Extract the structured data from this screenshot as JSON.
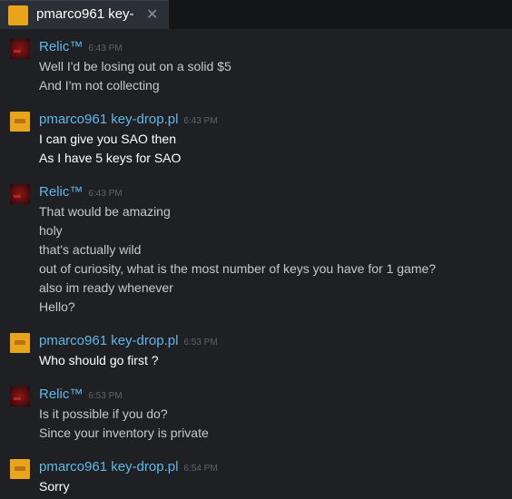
{
  "tab": {
    "title": "pmarco961 key-",
    "close_glyph": "✕"
  },
  "messages": [
    {
      "author": "Relic™",
      "time": "6:43 PM",
      "lines": [
        "Well I'd be losing out on a solid $5",
        "And I'm not collecting"
      ]
    },
    {
      "author": "pmarco961 key-drop.pl",
      "time": "6:43 PM",
      "lines": [
        "I can give you SAO then",
        "As I have 5 keys for SAO"
      ]
    },
    {
      "author": "Relic™",
      "time": "6:43 PM",
      "lines": [
        "That would be amazing",
        "holy",
        "that's actually wild",
        "out of curiosity, what is the most number of keys you have for 1 game?",
        "also im ready whenever",
        "Hello?"
      ]
    },
    {
      "author": "pmarco961 key-drop.pl",
      "time": "6:53 PM",
      "lines": [
        "Who should go first ?"
      ]
    },
    {
      "author": "Relic™",
      "time": "6:53 PM",
      "lines": [
        "Is it possible if you do?",
        "Since your inventory is private"
      ]
    },
    {
      "author": "pmarco961 key-drop.pl",
      "time": "6:54 PM",
      "lines": [
        "Sorry"
      ]
    }
  ]
}
